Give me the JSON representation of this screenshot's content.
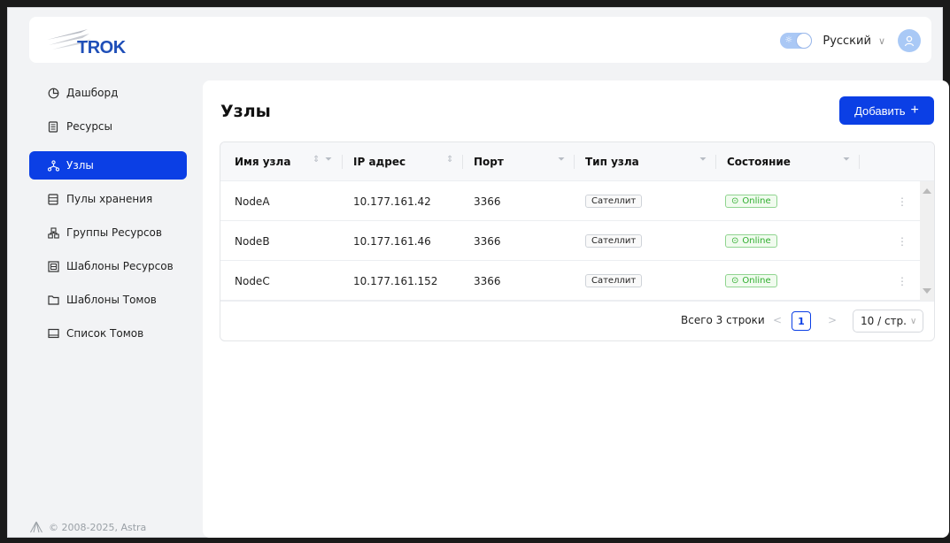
{
  "header": {
    "logo_text": "TROK",
    "theme_toggle": "on",
    "language": "Русский",
    "avatar_icon": "user-icon"
  },
  "sidebar": {
    "items": [
      {
        "label": "Дашборд",
        "icon": "dashboard-icon"
      },
      {
        "label": "Ресурсы",
        "icon": "resources-icon"
      },
      {
        "label": "Узлы",
        "icon": "nodes-icon",
        "active": true
      },
      {
        "label": "Пулы хранения",
        "icon": "storage-pools-icon"
      },
      {
        "label": "Группы Ресурсов",
        "icon": "resource-groups-icon"
      },
      {
        "label": "Шаблоны Ресурсов",
        "icon": "resource-templates-icon"
      },
      {
        "label": "Шаблоны Томов",
        "icon": "volume-templates-icon"
      },
      {
        "label": "Список Томов",
        "icon": "volume-list-icon"
      }
    ],
    "footer": "© 2008-2025, Astra"
  },
  "main": {
    "title": "Узлы",
    "add_button": "Добавить",
    "table": {
      "columns": [
        "Имя узла",
        "IP адрес",
        "Порт",
        "Тип узла",
        "Состояние"
      ],
      "rows": [
        {
          "name": "NodeA",
          "ip": "10.177.161.42",
          "port": "3366",
          "type": "Сателлит",
          "status": "Online"
        },
        {
          "name": "NodeB",
          "ip": "10.177.161.46",
          "port": "3366",
          "type": "Сателлит",
          "status": "Online"
        },
        {
          "name": "NodeC",
          "ip": "10.177.161.152",
          "port": "3366",
          "type": "Сателлит",
          "status": "Online"
        }
      ]
    },
    "pagination": {
      "total": "Всего 3 строки",
      "current": "1",
      "page_size": "10 / стр."
    }
  },
  "colors": {
    "accent": "#0b3fe5",
    "online": "#2fae2f",
    "background": "#f2f3f5"
  }
}
